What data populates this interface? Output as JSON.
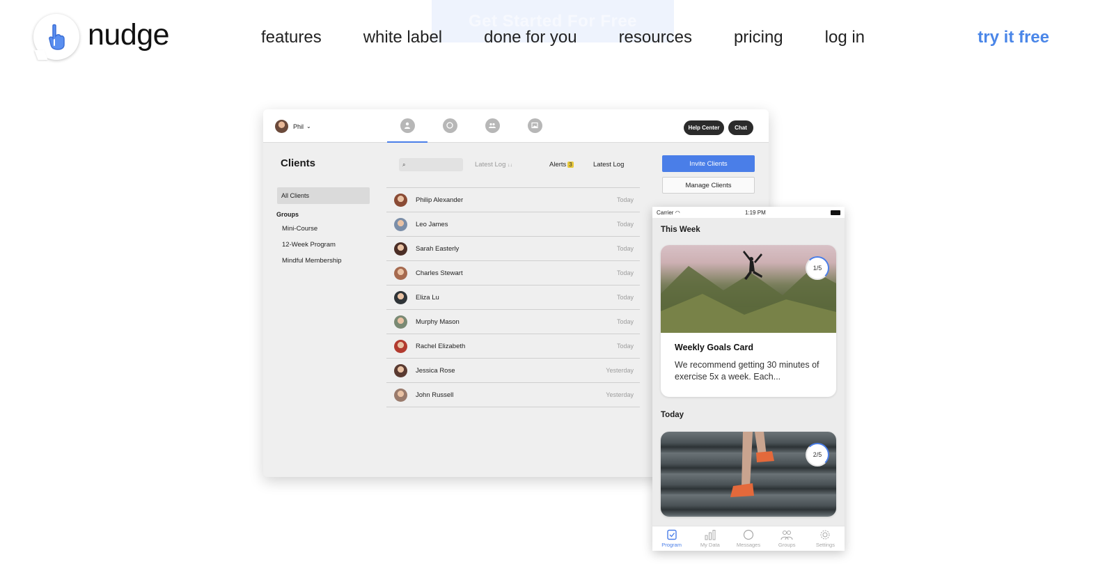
{
  "ghost_cta": {
    "label": "Get Started For Free"
  },
  "brand": {
    "name": "nudge",
    "accent": "#4a86e8"
  },
  "nav": {
    "items": [
      "features",
      "white label",
      "done for you",
      "resources",
      "pricing",
      "log in"
    ],
    "cta": "try it free"
  },
  "app": {
    "user": "Phil",
    "help_center": "Help Center",
    "chat": "Chat",
    "sidebar": {
      "title": "Clients",
      "all_clients": "All Clients",
      "groups_label": "Groups",
      "groups": [
        "Mini-Course",
        "12-Week Program",
        "Mindful Membership"
      ]
    },
    "toolbar": {
      "sort_label": "Latest Log",
      "sort_icon": "↓↓",
      "alerts_label": "Alerts",
      "alerts_count": "3",
      "latest_log_label": "Latest Log"
    },
    "buttons": {
      "invite": "Invite Clients",
      "manage": "Manage Clients"
    },
    "clients": [
      {
        "name": "Philip Alexander",
        "when": "Today",
        "color": "#8a4b35"
      },
      {
        "name": "Leo James",
        "when": "Today",
        "color": "#7b8ea8"
      },
      {
        "name": "Sarah Easterly",
        "when": "Today",
        "color": "#4b2e26"
      },
      {
        "name": "Charles Stewart",
        "when": "Today",
        "color": "#a66a4f"
      },
      {
        "name": "Eliza Lu",
        "when": "Today",
        "color": "#2f3438"
      },
      {
        "name": "Murphy Mason",
        "when": "Today",
        "color": "#7a8a74"
      },
      {
        "name": "Rachel Elizabeth",
        "when": "Today",
        "color": "#b23b2f"
      },
      {
        "name": "Jessica Rose",
        "when": "Yesterday",
        "color": "#5a3a31"
      },
      {
        "name": "John Russell",
        "when": "Yesterday",
        "color": "#9a7b6c"
      }
    ]
  },
  "phone": {
    "carrier": "Carrier",
    "time": "1:19 PM",
    "this_week": "This Week",
    "card1": {
      "progress": "1/5",
      "title": "Weekly Goals Card",
      "text": "We recommend getting 30 minutes of exercise 5x a week. Each..."
    },
    "today": "Today",
    "card2": {
      "progress": "2/5"
    },
    "tabbar": [
      "Program",
      "My Data",
      "Messages",
      "Groups",
      "Settings"
    ]
  }
}
